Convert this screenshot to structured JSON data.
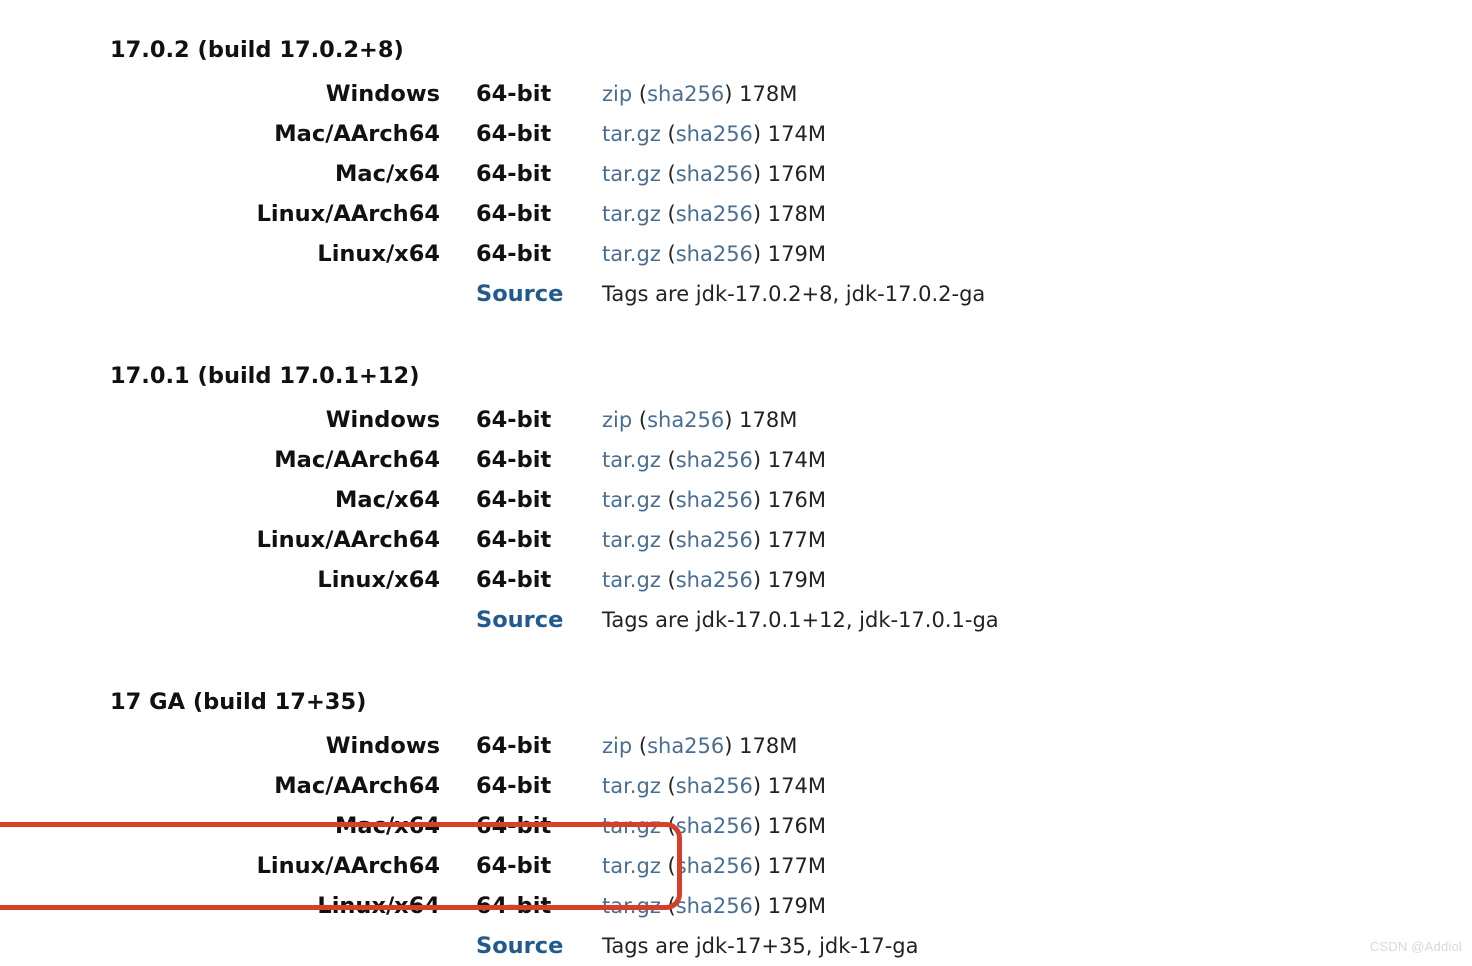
{
  "watermark": "CSDN @Addiol",
  "sha_label": "sha256",
  "source_label": "Source",
  "versions": [
    {
      "title": "17.0.2 (build 17.0.2+8)",
      "rows": [
        {
          "os": "Windows",
          "arch": "64-bit",
          "fmt": "zip",
          "size": "178M"
        },
        {
          "os": "Mac/AArch64",
          "arch": "64-bit",
          "fmt": "tar.gz",
          "size": "174M"
        },
        {
          "os": "Mac/x64",
          "arch": "64-bit",
          "fmt": "tar.gz",
          "size": "176M"
        },
        {
          "os": "Linux/AArch64",
          "arch": "64-bit",
          "fmt": "tar.gz",
          "size": "178M"
        },
        {
          "os": "Linux/x64",
          "arch": "64-bit",
          "fmt": "tar.gz",
          "size": "179M"
        }
      ],
      "source_tags": "Tags are jdk-17.0.2+8, jdk-17.0.2-ga"
    },
    {
      "title": "17.0.1 (build 17.0.1+12)",
      "rows": [
        {
          "os": "Windows",
          "arch": "64-bit",
          "fmt": "zip",
          "size": "178M"
        },
        {
          "os": "Mac/AArch64",
          "arch": "64-bit",
          "fmt": "tar.gz",
          "size": "174M"
        },
        {
          "os": "Mac/x64",
          "arch": "64-bit",
          "fmt": "tar.gz",
          "size": "176M"
        },
        {
          "os": "Linux/AArch64",
          "arch": "64-bit",
          "fmt": "tar.gz",
          "size": "177M"
        },
        {
          "os": "Linux/x64",
          "arch": "64-bit",
          "fmt": "tar.gz",
          "size": "179M"
        }
      ],
      "source_tags": "Tags are jdk-17.0.1+12, jdk-17.0.1-ga"
    },
    {
      "title": "17 GA (build 17+35)",
      "rows": [
        {
          "os": "Windows",
          "arch": "64-bit",
          "fmt": "zip",
          "size": "178M"
        },
        {
          "os": "Mac/AArch64",
          "arch": "64-bit",
          "fmt": "tar.gz",
          "size": "174M"
        },
        {
          "os": "Mac/x64",
          "arch": "64-bit",
          "fmt": "tar.gz",
          "size": "176M"
        },
        {
          "os": "Linux/AArch64",
          "arch": "64-bit",
          "fmt": "tar.gz",
          "size": "177M"
        },
        {
          "os": "Linux/x64",
          "arch": "64-bit",
          "fmt": "tar.gz",
          "size": "179M"
        }
      ],
      "source_tags": "Tags are jdk-17+35, jdk-17-ga"
    }
  ],
  "highlight": {
    "version_index": 2,
    "row_index": 3
  }
}
